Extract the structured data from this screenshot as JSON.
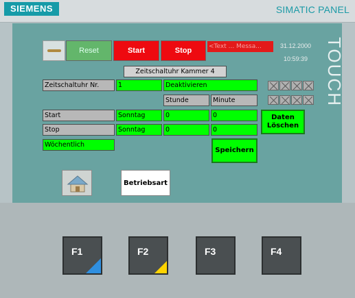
{
  "device": {
    "brand": "SIEMENS",
    "model": "SIMATIC PANEL",
    "touch_label": "TOUCH"
  },
  "header": {
    "reset_label": "Reset",
    "start_label": "Start",
    "stop_label": "Stop",
    "alarm_text": "<Text ... Messa...",
    "date": "31.12.2000",
    "time": "10:59:39"
  },
  "screen": {
    "title": "Zeitschaltuhr Kammer 4",
    "timer_no_label": "Zeitschaltuhr Nr.",
    "timer_no_value": "1",
    "deactivate_label": "Deaktivieren",
    "hour_header": "Stunde",
    "minute_header": "Minute",
    "start_label": "Start",
    "start_day": "Sonntag",
    "start_hour": "0",
    "start_minute": "0",
    "stop_label": "Stop",
    "stop_day": "Sonntag",
    "stop_hour": "0",
    "stop_minute": "0",
    "weekly_label": "Wöchentlich",
    "save_label": "Speichern",
    "delete_data_label": "Daten Löschen",
    "mode_label": "Betriebsart"
  },
  "function_keys": [
    {
      "label": "F1",
      "corner_color": "#2f8fe0"
    },
    {
      "label": "F2",
      "corner_color": "#ffd400"
    },
    {
      "label": "F3",
      "corner_color": ""
    },
    {
      "label": "F4",
      "corner_color": ""
    }
  ],
  "colors": {
    "accent_green": "#00ff00",
    "accent_red": "#ee0a10",
    "screen_teal": "#69a3a1",
    "brand_teal": "#169ba8"
  }
}
